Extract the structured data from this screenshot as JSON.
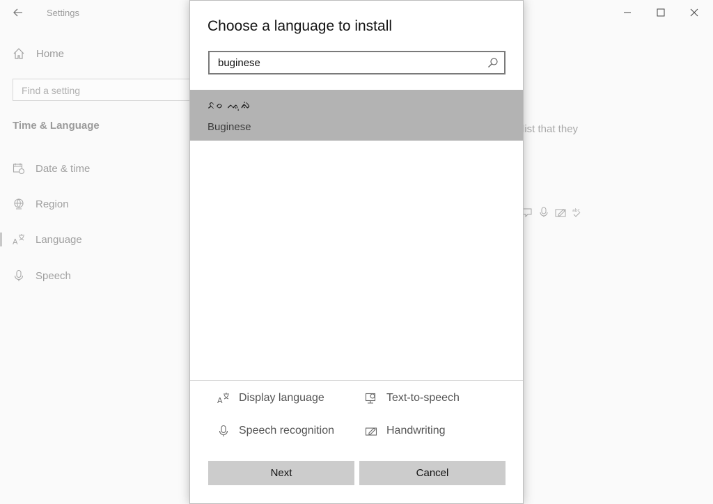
{
  "window": {
    "title": "Settings"
  },
  "sidebar": {
    "home_label": "Home",
    "search_placeholder": "Find a setting",
    "section_title": "Time & Language",
    "items": [
      {
        "label": "Date & time",
        "icon": "calendar-clock-icon"
      },
      {
        "label": "Region",
        "icon": "globe-icon"
      },
      {
        "label": "Language",
        "icon": "language-icon",
        "selected": true
      },
      {
        "label": "Speech",
        "icon": "microphone-icon"
      }
    ]
  },
  "background": {
    "partial_text": "list that they"
  },
  "dialog": {
    "title": "Choose a language to install",
    "search_value": "buginese",
    "results": [
      {
        "native": "ᨅᨔ ᨕᨘᨁᨗ",
        "name": "Buginese",
        "selected": true
      }
    ],
    "features": [
      {
        "label": "Display language",
        "icon": "display-language-icon"
      },
      {
        "label": "Text-to-speech",
        "icon": "text-to-speech-icon"
      },
      {
        "label": "Speech recognition",
        "icon": "microphone-icon"
      },
      {
        "label": "Handwriting",
        "icon": "handwriting-icon"
      }
    ],
    "buttons": {
      "next": "Next",
      "cancel": "Cancel"
    }
  },
  "colors": {
    "selected_row": "#b3b3b3",
    "button_bg": "#cccccc"
  }
}
